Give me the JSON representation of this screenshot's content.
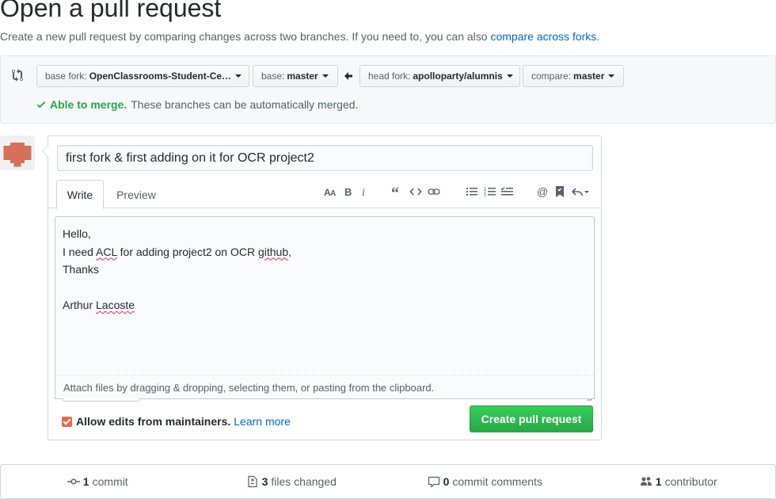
{
  "page": {
    "title": "Open a pull request",
    "subtitle": "Create a new pull request by comparing changes across two branches. If you need to, you can also",
    "subtitle_link": "compare across forks."
  },
  "range": {
    "base_fork_label": "base fork:",
    "base_fork_value": "OpenClassrooms-Student-Ce…",
    "base_label": "base:",
    "base_value": "master",
    "head_fork_label": "head fork:",
    "head_fork_value": "apolloparty/alumnis",
    "compare_label": "compare:",
    "compare_value": "master",
    "merge_ok": "Able to merge.",
    "merge_text": "These branches can be automatically merged.",
    "ok_color": "#28a745"
  },
  "form": {
    "title_value": "first fork & first adding on it for OCR project2",
    "tabs": [
      {
        "label": "Write",
        "active": true
      },
      {
        "label": "Preview",
        "active": false
      }
    ],
    "toolbar": [
      "header-icon",
      "bold-icon",
      "italic-icon",
      "quote-icon",
      "code-icon",
      "link-icon",
      "unordered-list-icon",
      "ordered-list-icon",
      "task-list-icon",
      "mention-icon",
      "reference-icon",
      "reply-icon"
    ],
    "body_lines": {
      "l1": "Hello,",
      "l2a": "I need ",
      "l2b": "ACL",
      "l2c": " for adding project2 on OCR ",
      "l2d": "github",
      "l2e": ",",
      "l3": "Thanks",
      "l5a": "Arthur ",
      "l5b": "Lacoste"
    },
    "attach_text": "Attach files by dragging & dropping, selecting them, or pasting from the clipboard.",
    "maintainers_label": "Allow edits from maintainers.",
    "learn_more": "Learn more",
    "maintainers_checked": true,
    "submit_label": "Create pull request"
  },
  "stats": [
    {
      "icon": "commit-icon",
      "count": "1",
      "label": "commit"
    },
    {
      "icon": "file-diff-icon",
      "count": "3",
      "label": "files changed"
    },
    {
      "icon": "comment-icon",
      "count": "0",
      "label": "commit comments"
    },
    {
      "icon": "people-icon",
      "count": "1",
      "label": "contributor"
    }
  ],
  "colors": {
    "link": "#0366d6",
    "primary_button": "#28a745",
    "avatar": "#d5705a"
  }
}
